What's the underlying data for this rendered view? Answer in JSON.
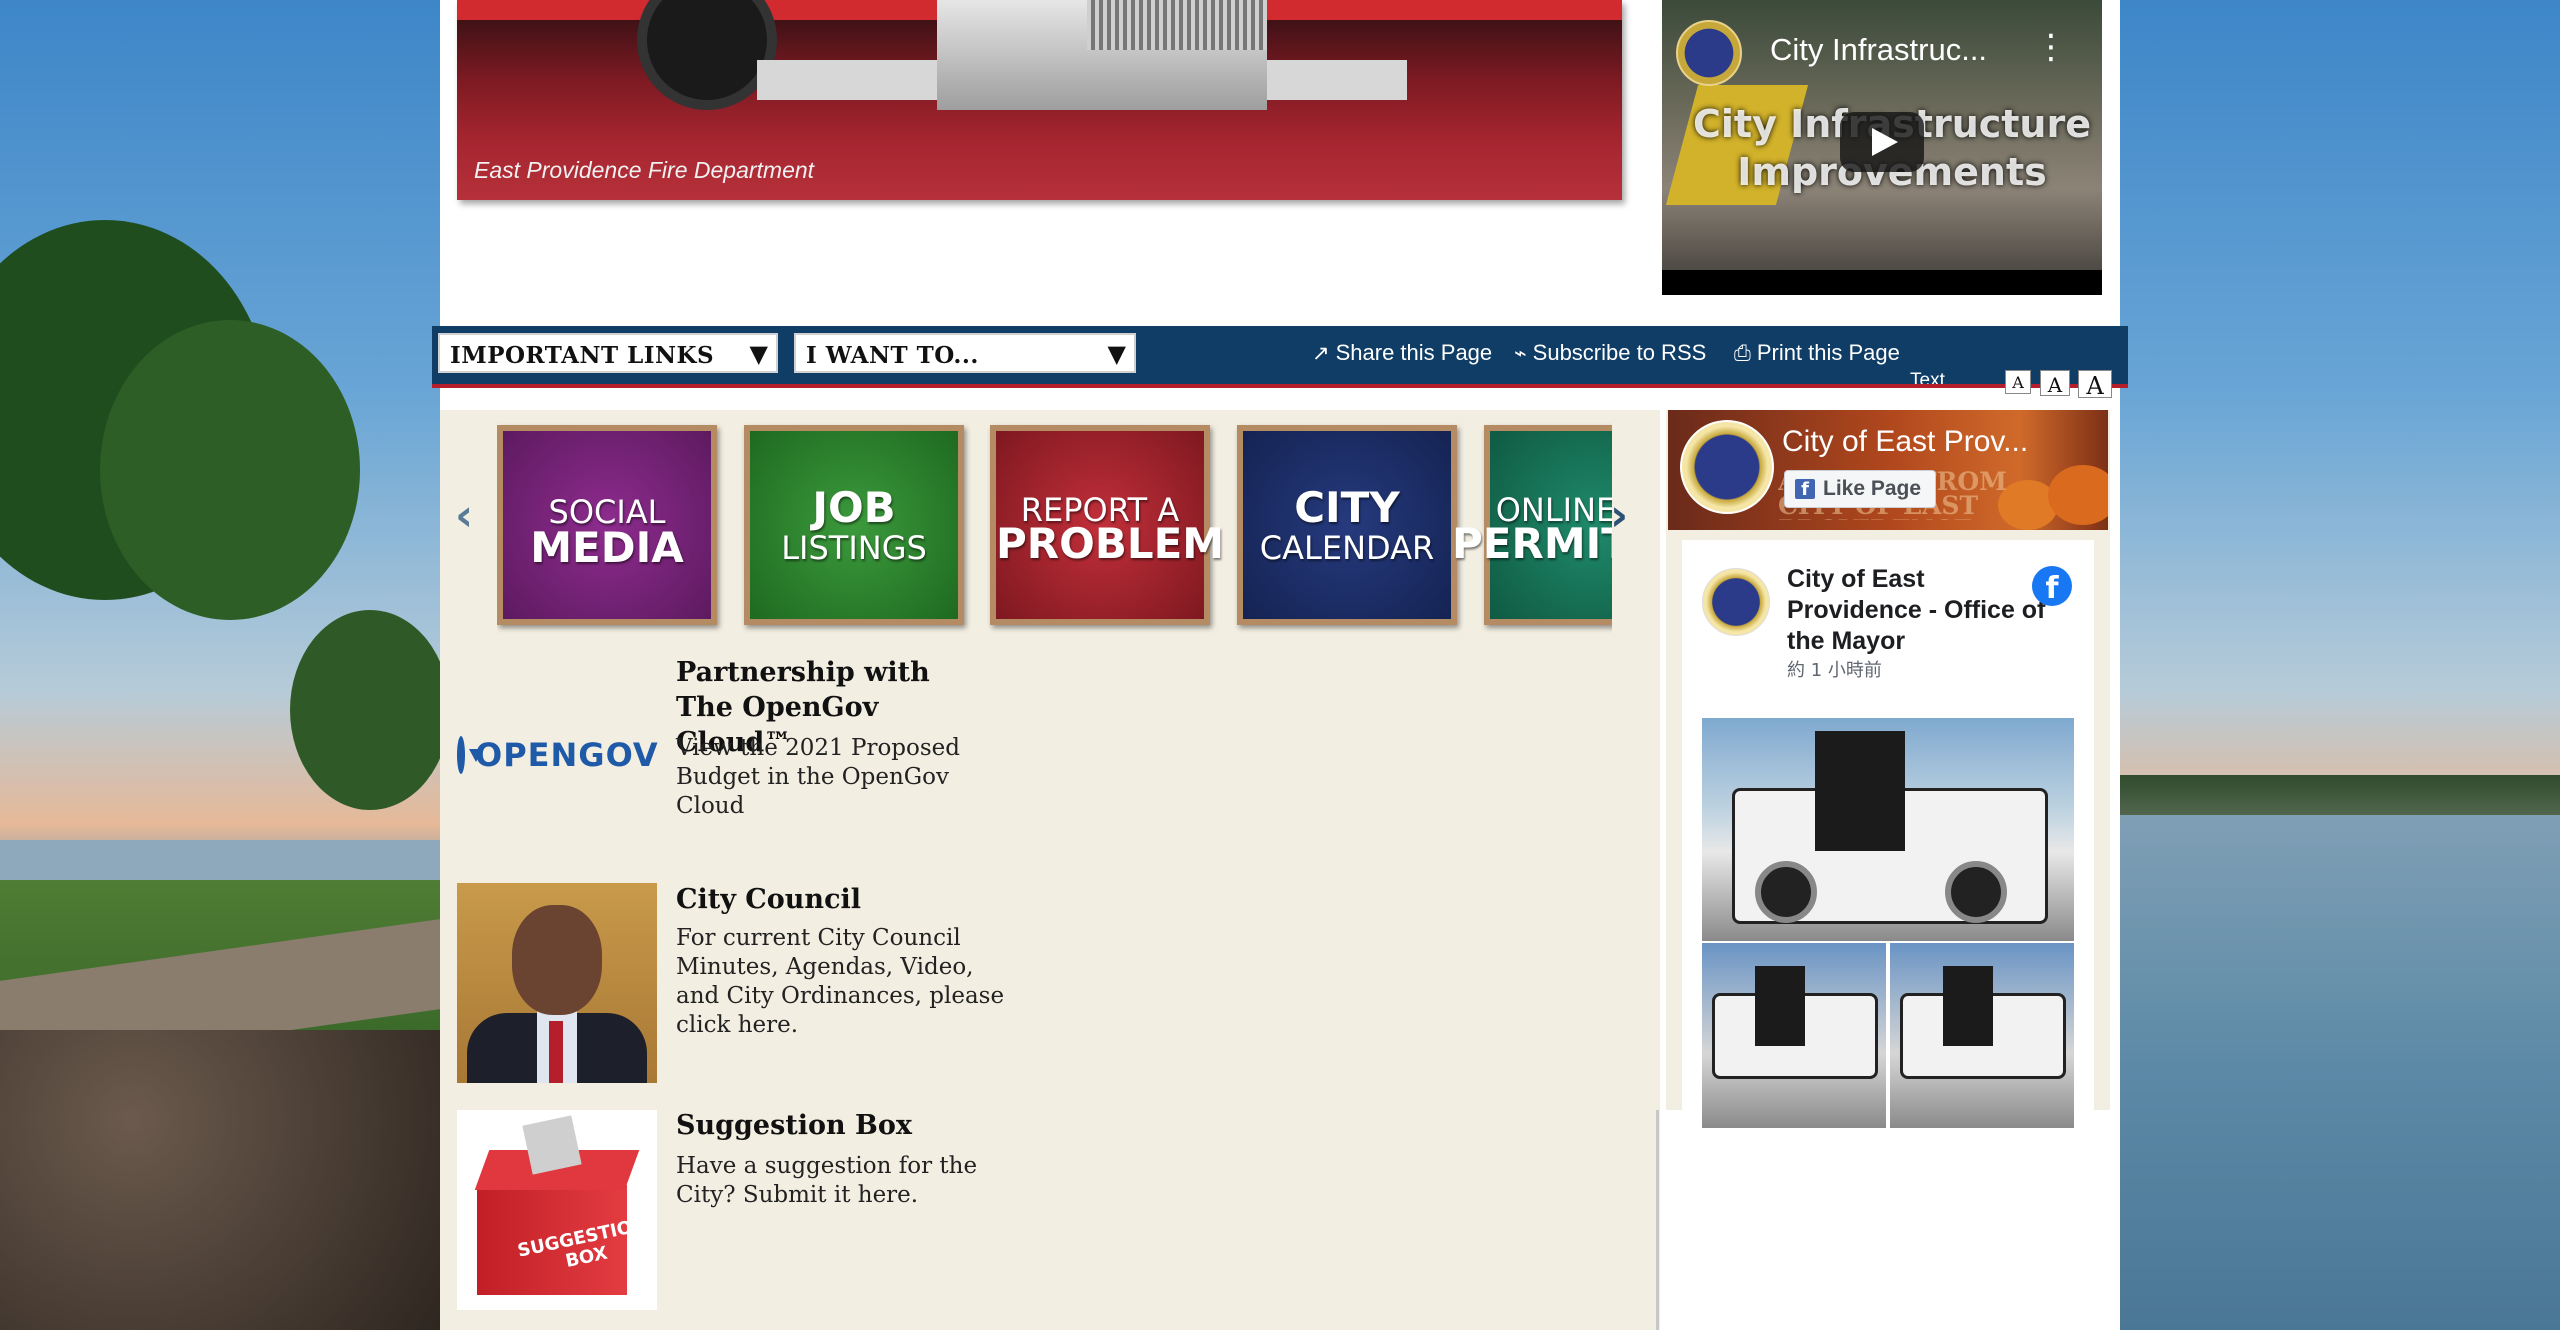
{
  "hero": {
    "caption": "East Providence Fire Department"
  },
  "video": {
    "title": "City Infrastruc...",
    "overlay_line1": "City Infrastructure",
    "overlay_line2": "Improvements",
    "menu_icon": "kebab-icon",
    "play_icon": "play-icon"
  },
  "toolbar": {
    "important_links": "IMPORTANT LINKS",
    "i_want_to": "I WANT TO...",
    "share": "Share this Page",
    "rss": "Subscribe to RSS",
    "print": "Print this Page",
    "text_label": "Text",
    "size_small": "A",
    "size_medium": "A",
    "size_large": "A",
    "colors": {
      "bar": "#0f3d66",
      "accent": "#b41f2b"
    }
  },
  "carousel": {
    "prev": "‹",
    "next": "›",
    "tiles": [
      {
        "line1": "SOCIAL",
        "line2": "MEDIA"
      },
      {
        "line1": "JOB",
        "line2": "LISTINGS"
      },
      {
        "line1": "REPORT A",
        "line2": "PROBLEM"
      },
      {
        "line1": "CITY",
        "line2": "CALENDAR"
      },
      {
        "line1": "ONLINE",
        "line2": "PERMITS"
      }
    ]
  },
  "items": [
    {
      "logo_text": "OPENGOV",
      "title": "Partnership with The OpenGov Cloud™",
      "desc": "View the 2021 Proposed Budget in the OpenGov Cloud"
    },
    {
      "title": "City Council",
      "desc": "For current City Council Minutes, Agendas, Video, and City Ordinances, please click here."
    },
    {
      "image_text": "SUGGESTION BOX",
      "title": "Suggestion Box",
      "desc": "Have a suggestion for the City? Submit it here."
    }
  ],
  "facebook": {
    "page_name": "City of East Prov...",
    "like_label": "Like Page",
    "cover_text": "AUTUMN FROM CITY OF EAST PROVIDENCE",
    "post_author": "City of East Providence - Office of the Mayor",
    "post_time": "約 1 小時前",
    "brand_color": "#1877f2"
  }
}
